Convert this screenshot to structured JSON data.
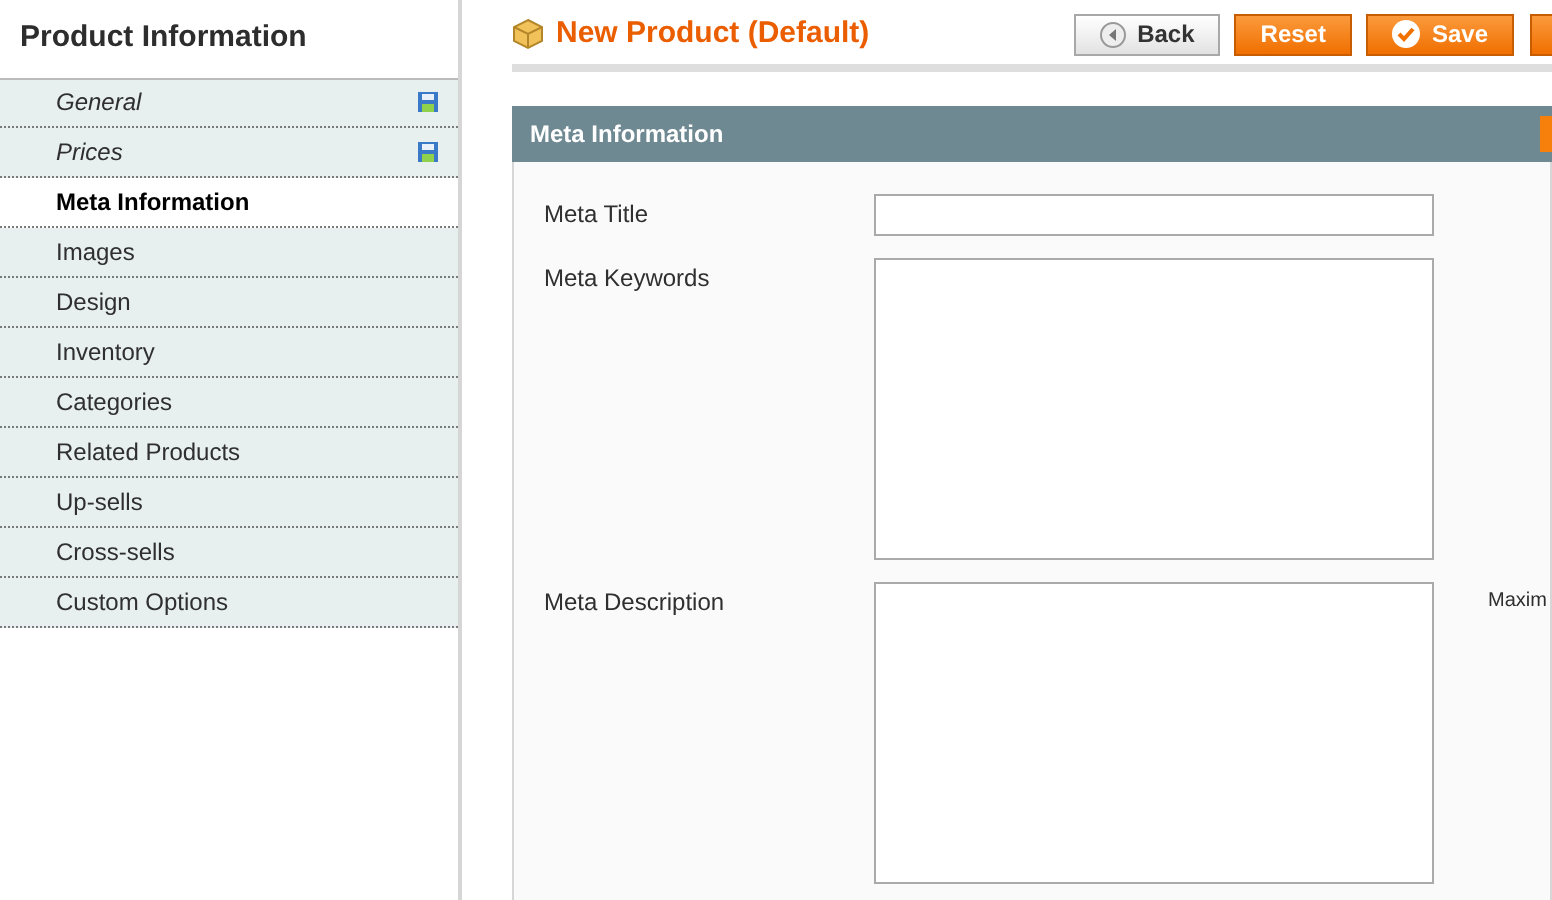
{
  "sidebar": {
    "title": "Product Information",
    "tabs": [
      {
        "label": "General",
        "selected": false,
        "changed": true
      },
      {
        "label": "Prices",
        "selected": false,
        "changed": true
      },
      {
        "label": "Meta Information",
        "selected": true,
        "changed": false
      },
      {
        "label": "Images",
        "selected": false,
        "changed": false
      },
      {
        "label": "Design",
        "selected": false,
        "changed": false
      },
      {
        "label": "Inventory",
        "selected": false,
        "changed": false
      },
      {
        "label": "Categories",
        "selected": false,
        "changed": false
      },
      {
        "label": "Related Products",
        "selected": false,
        "changed": false
      },
      {
        "label": "Up-sells",
        "selected": false,
        "changed": false
      },
      {
        "label": "Cross-sells",
        "selected": false,
        "changed": false
      },
      {
        "label": "Custom Options",
        "selected": false,
        "changed": false
      }
    ]
  },
  "header": {
    "title": "New Product (Default)",
    "buttons": [
      {
        "label": "Back",
        "kind": "back"
      },
      {
        "label": "Reset",
        "kind": "plain"
      },
      {
        "label": "Save",
        "kind": "save"
      }
    ]
  },
  "section": {
    "title": "Meta Information",
    "fields": [
      {
        "label": "Meta Title",
        "kind": "input"
      },
      {
        "label": "Meta Keywords",
        "kind": "textarea"
      },
      {
        "label": "Meta Description",
        "kind": "textarea",
        "note": "Maxim"
      }
    ]
  }
}
